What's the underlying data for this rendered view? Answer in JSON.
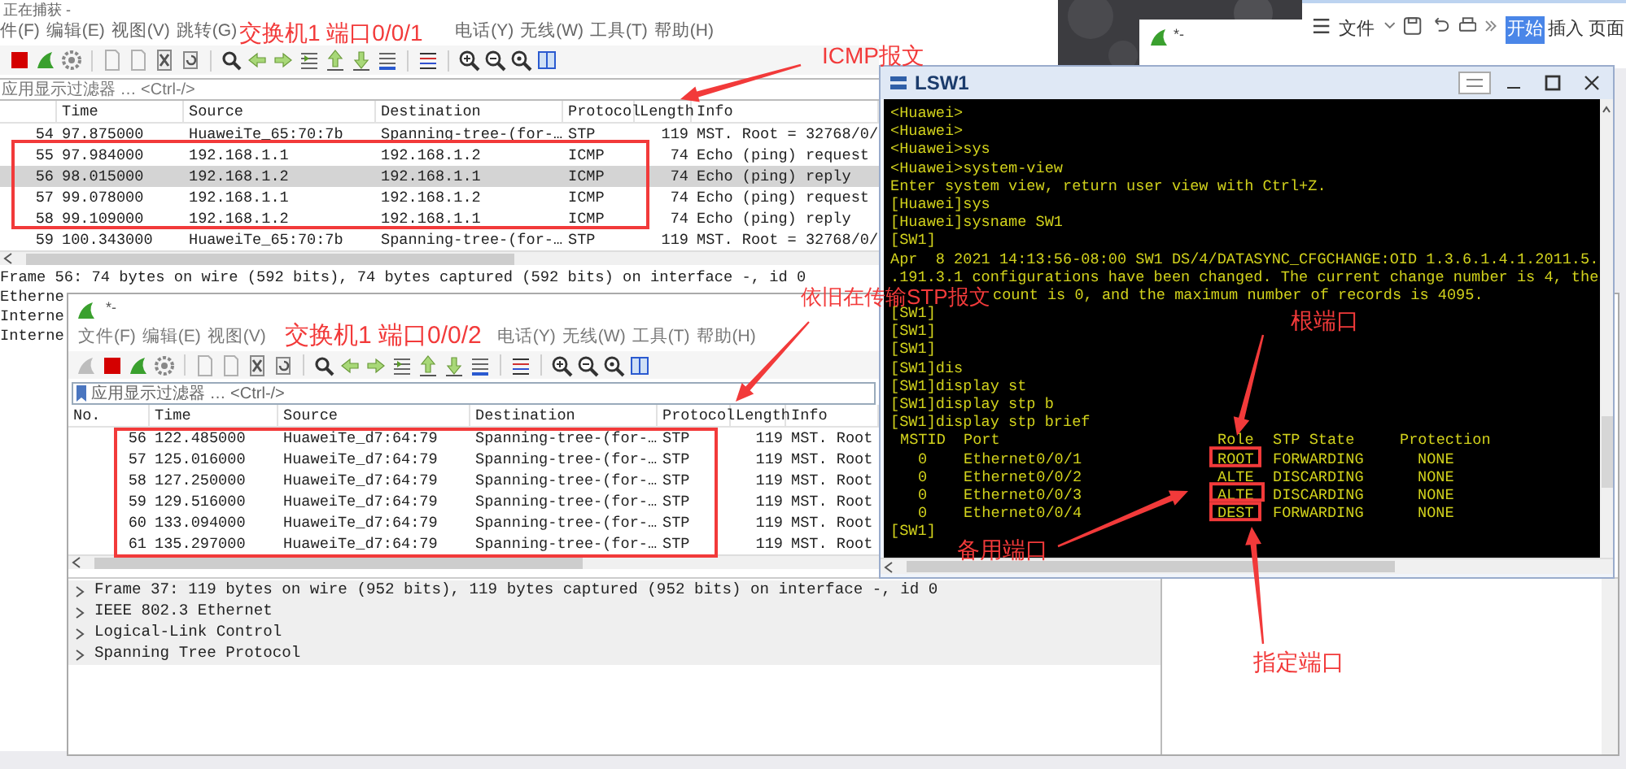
{
  "back_capture": {
    "title": "正在捕获 -",
    "menu": [
      {
        "label": "件(F)"
      },
      {
        "label": "编辑(E)"
      },
      {
        "label": "视图(V)"
      },
      {
        "label": "跳转(G)"
      },
      {
        "label": "电话(Y)",
        "after_gap": true
      },
      {
        "label": "无线(W)"
      },
      {
        "label": "工具(T)"
      },
      {
        "label": "帮助(H)"
      }
    ],
    "filter": {
      "placeholder": "应用显示过滤器 … <Ctrl-/>"
    },
    "columns": [
      "Time",
      "Source",
      "Destination",
      "Protocol",
      "Length",
      "Info"
    ],
    "rows": [
      {
        "no": "54",
        "time": "97.875000",
        "source": "HuaweiTe_65:70:7b",
        "destination": "Spanning-tree-(for-…",
        "protocol": "STP",
        "length": "119",
        "info": "MST. Root = 32768/0/",
        "selected": false
      },
      {
        "no": "55",
        "time": "97.984000",
        "source": "192.168.1.1",
        "destination": "192.168.1.2",
        "protocol": "ICMP",
        "length": "74",
        "info": "Echo (ping) request",
        "selected": false
      },
      {
        "no": "56",
        "time": "98.015000",
        "source": "192.168.1.2",
        "destination": "192.168.1.1",
        "protocol": "ICMP",
        "length": "74",
        "info": "Echo (ping) reply",
        "selected": true
      },
      {
        "no": "57",
        "time": "99.078000",
        "source": "192.168.1.1",
        "destination": "192.168.1.2",
        "protocol": "ICMP",
        "length": "74",
        "info": "Echo (ping) request",
        "selected": false
      },
      {
        "no": "58",
        "time": "99.109000",
        "source": "192.168.1.2",
        "destination": "192.168.1.1",
        "protocol": "ICMP",
        "length": "74",
        "info": "Echo (ping) reply",
        "selected": false
      },
      {
        "no": "59",
        "time": "100.343000",
        "source": "HuaweiTe_65:70:7b",
        "destination": "Spanning-tree-(for-…",
        "protocol": "STP",
        "length": "119",
        "info": "MST. Root = 32768/0/",
        "selected": false
      }
    ],
    "details": [
      {
        "text": "Frame 56: 74 bytes on wire (592 bits), 74 bytes captured (592 bits) on interface -, id 0"
      },
      {
        "text": "Etherne"
      },
      {
        "text": "Interne"
      },
      {
        "text": "Interne"
      }
    ]
  },
  "front_capture": {
    "title": "*-",
    "menu": [
      {
        "label": "文件(F)"
      },
      {
        "label": "编辑(E)"
      },
      {
        "label": "视图(V)"
      },
      {
        "label": "电话(Y)",
        "after_gap": true
      },
      {
        "label": "无线(W)"
      },
      {
        "label": "工具(T)"
      },
      {
        "label": "帮助(H)"
      }
    ],
    "filter": {
      "placeholder": "应用显示过滤器 … <Ctrl-/>"
    },
    "columns": [
      "No.",
      "Time",
      "Source",
      "Destination",
      "Protocol",
      "Length",
      "Info"
    ],
    "rows": [
      {
        "no": "56",
        "time": "122.485000",
        "source": "HuaweiTe_d7:64:79",
        "destination": "Spanning-tree-(for-…",
        "protocol": "STP",
        "length": "119",
        "info": "MST. Root",
        "selected": false
      },
      {
        "no": "57",
        "time": "125.016000",
        "source": "HuaweiTe_d7:64:79",
        "destination": "Spanning-tree-(for-…",
        "protocol": "STP",
        "length": "119",
        "info": "MST. Root",
        "selected": false
      },
      {
        "no": "58",
        "time": "127.250000",
        "source": "HuaweiTe_d7:64:79",
        "destination": "Spanning-tree-(for-…",
        "protocol": "STP",
        "length": "119",
        "info": "MST. Root",
        "selected": false
      },
      {
        "no": "59",
        "time": "129.516000",
        "source": "HuaweiTe_d7:64:79",
        "destination": "Spanning-tree-(for-…",
        "protocol": "STP",
        "length": "119",
        "info": "MST. Root",
        "selected": false
      },
      {
        "no": "60",
        "time": "133.094000",
        "source": "HuaweiTe_d7:64:79",
        "destination": "Spanning-tree-(for-…",
        "protocol": "STP",
        "length": "119",
        "info": "MST. Root",
        "selected": false
      },
      {
        "no": "61",
        "time": "135.297000",
        "source": "HuaweiTe_d7:64:79",
        "destination": "Spanning-tree-(for-…",
        "protocol": "STP",
        "length": "119",
        "info": "MST. Root",
        "selected": false
      }
    ],
    "details": [
      {
        "text": "Frame 37: 119 bytes on wire (952 bits), 119 bytes captured (952 bits) on interface -, id 0",
        "expanded": false
      },
      {
        "text": "IEEE 802.3 Ethernet",
        "expanded": false
      },
      {
        "text": "Logical-Link Control",
        "expanded": false
      },
      {
        "text": "Spanning Tree Protocol",
        "expanded": false
      }
    ]
  },
  "small_capture": {
    "title": "*-"
  },
  "word_toolbar": {
    "menu": "文件",
    "tabs": [
      {
        "label": "开始",
        "selected": true
      },
      {
        "label": "插入",
        "selected": false
      },
      {
        "label": "页面",
        "selected": false
      }
    ]
  },
  "console": {
    "title": "LSW1",
    "lines_before": [
      "<Huawei>",
      "<Huawei>",
      "<Huawei>sys",
      "<Huawei>system-view",
      "Enter system view, return user view with Ctrl+Z.",
      "[Huawei]sys",
      "[Huawei]sysname SW1",
      "[SW1]",
      "Apr  8 2021 14:13:56-08:00 SW1 DS/4/DATASYNC_CFGCHANGE:OID 1.3.6.1.4.1.2011.5.",
      ".191.3.1 configurations have been changed. The current change number is 4, the"
    ],
    "covered_line": "count is 0, and the maximum number of records is 4095.",
    "lines_mid": [
      "[SW1]",
      "[SW1]",
      "[SW1]",
      "[SW1]dis",
      "[SW1]display st",
      "[SW1]display stp b",
      "[SW1]display stp brief"
    ],
    "table_header": [
      "MSTID",
      "Port",
      "Role",
      "STP State",
      "Protection"
    ],
    "table_rows": [
      {
        "mstid": "0",
        "port": "Ethernet0/0/1",
        "role": "ROOT",
        "state": "FORWARDING",
        "protection": "NONE"
      },
      {
        "mstid": "0",
        "port": "Ethernet0/0/2",
        "role": "ALTE",
        "state": "DISCARDING",
        "protection": "NONE"
      },
      {
        "mstid": "0",
        "port": "Ethernet0/0/3",
        "role": "ALTE",
        "state": "DISCARDING",
        "protection": "NONE"
      },
      {
        "mstid": "0",
        "port": "Ethernet0/0/4",
        "role": "DEST",
        "state": "FORWARDING",
        "protection": "NONE"
      }
    ],
    "lines_after": [
      "[SW1]"
    ]
  },
  "annotations": [
    {
      "text": "交换机1 端口0/0/1"
    },
    {
      "text": "ICMP报文"
    },
    {
      "text": "依旧在传输STP报文"
    },
    {
      "text": "交换机1 端口0/0/2"
    },
    {
      "text": "根端口"
    },
    {
      "text": "备用端口"
    },
    {
      "text": "指定端口"
    }
  ]
}
